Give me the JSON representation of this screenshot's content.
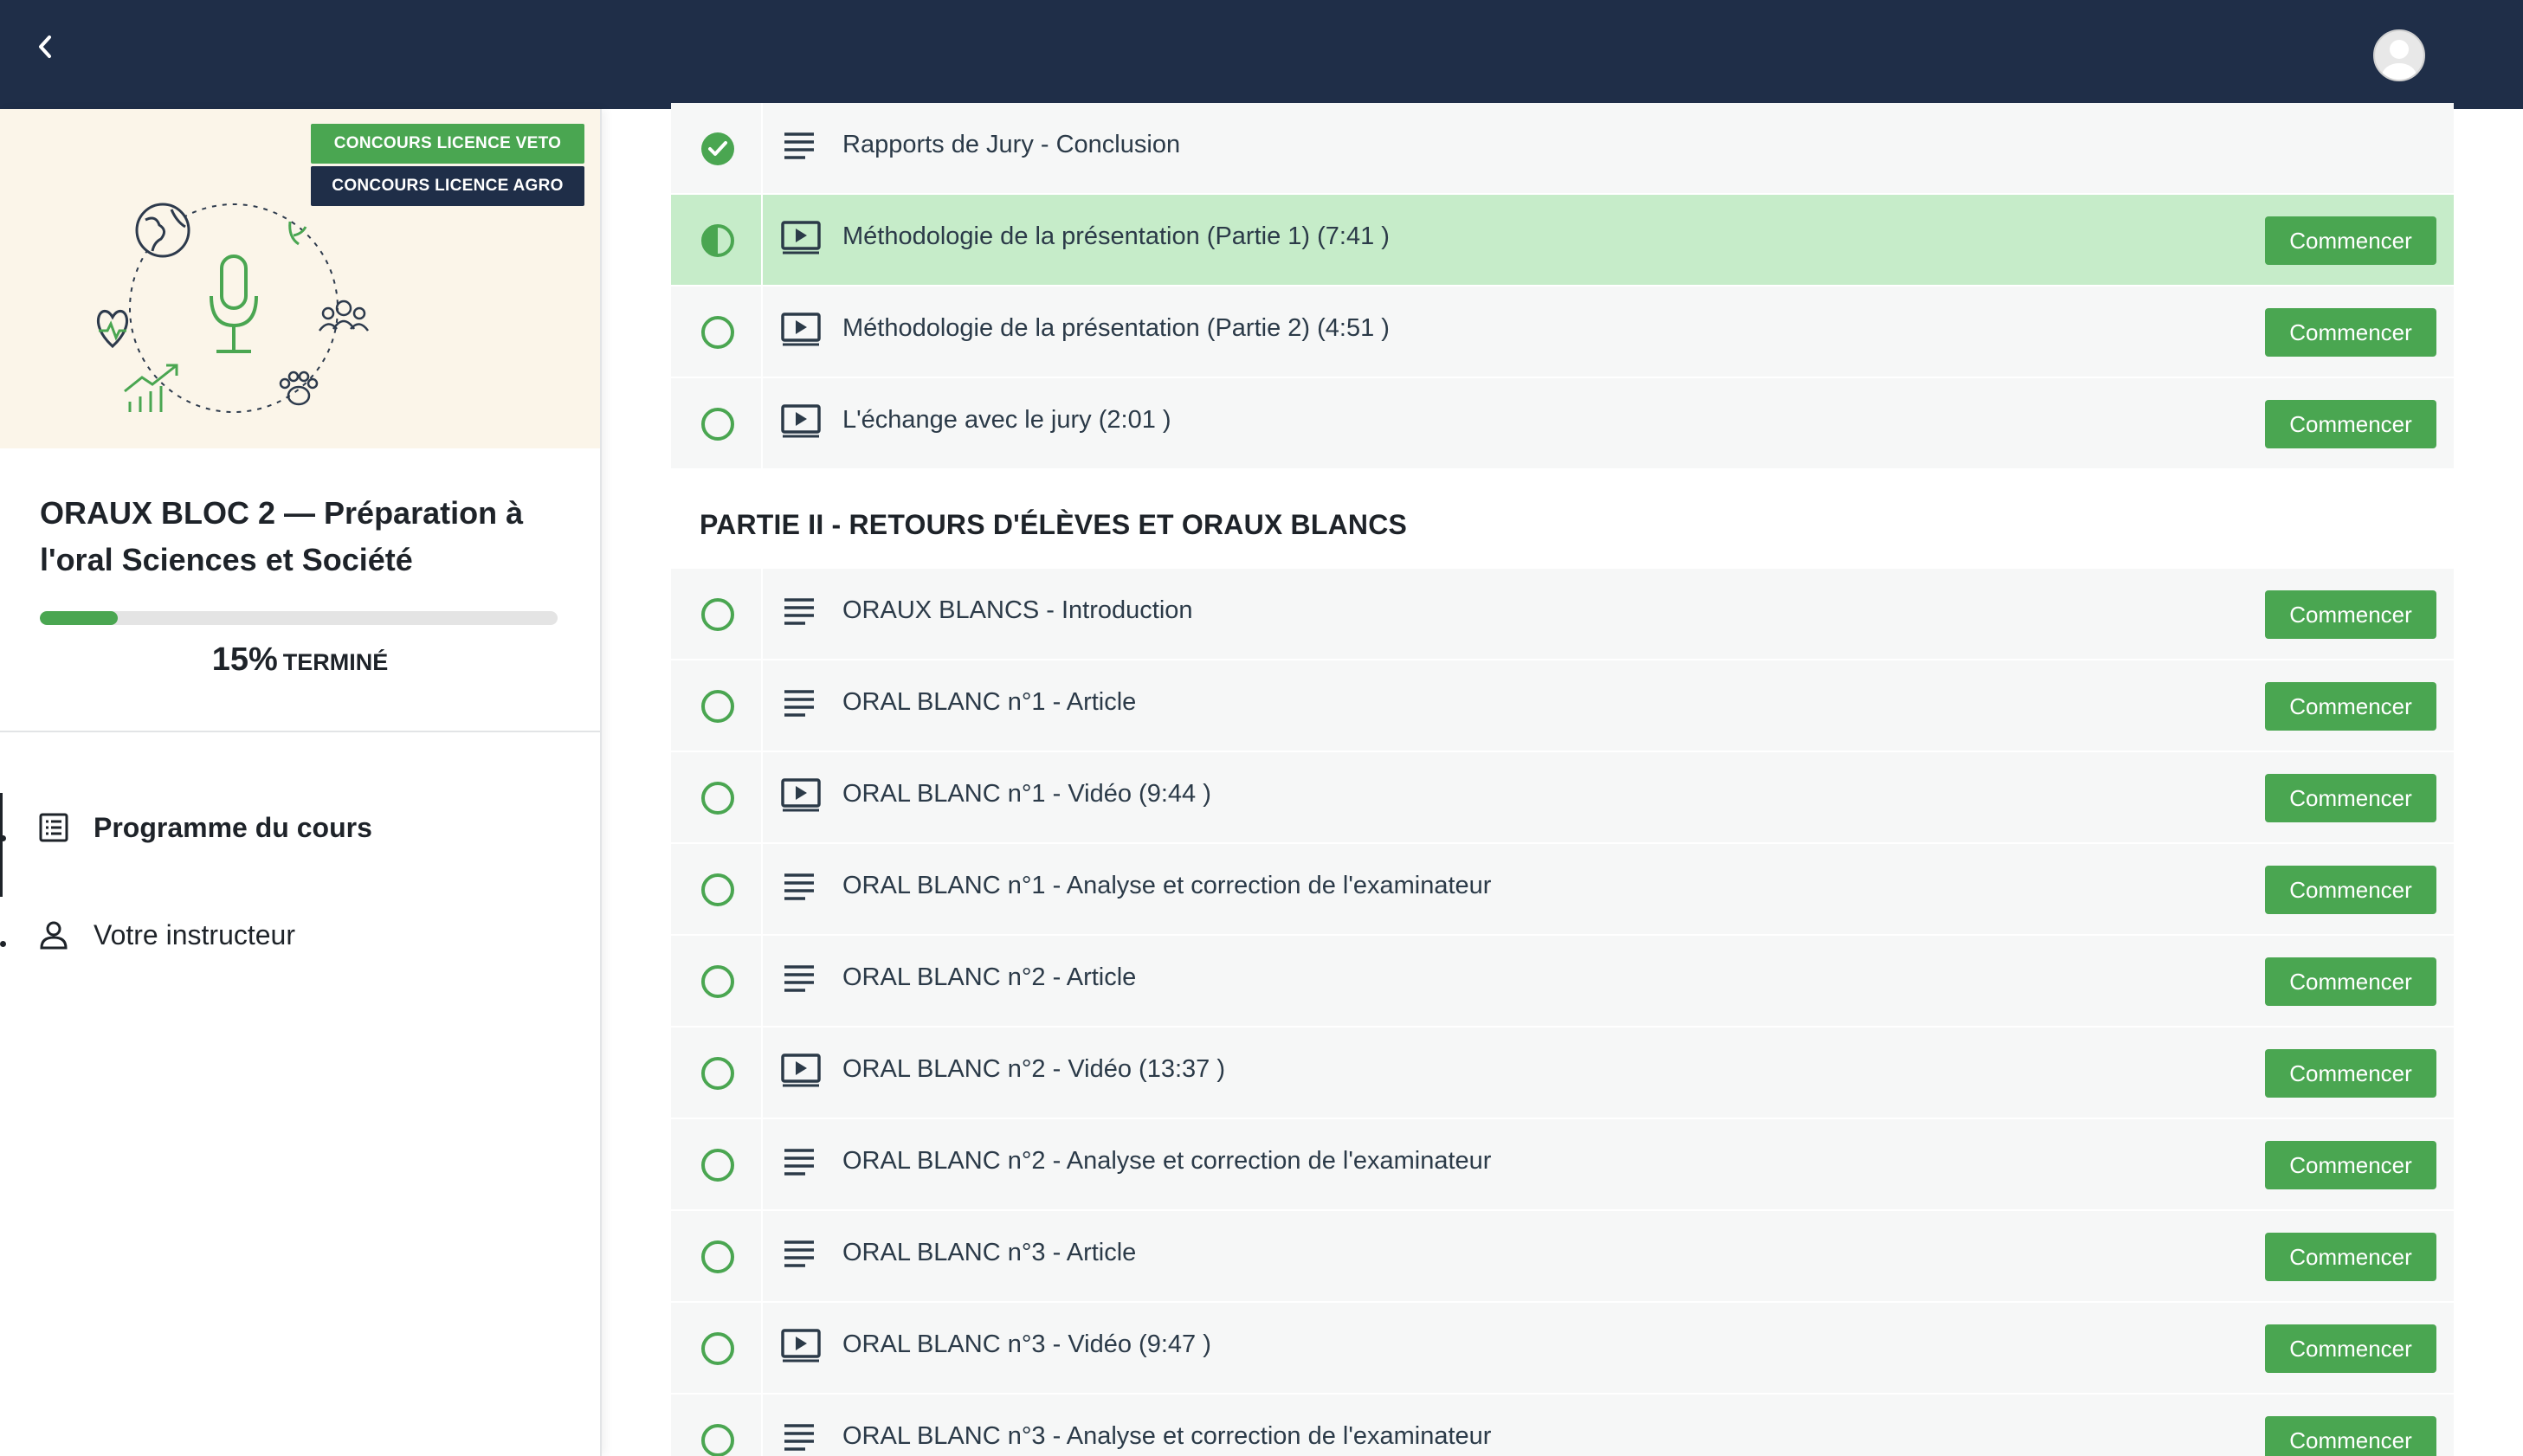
{
  "header": {
    "back_label": "‹",
    "avatar_label": "user-avatar"
  },
  "sidebar": {
    "badges": [
      "CONCOURS LICENCE VETO",
      "CONCOURS LICENCE AGRO"
    ],
    "course_title": "ORAUX BLOC 2 — Préparation à l'oral Sciences et Société",
    "progress": {
      "percent_value": 15,
      "percent_label": "15%",
      "status_label": "TERMINÉ"
    },
    "nav": [
      {
        "label": "Programme du cours",
        "icon": "list-icon",
        "active": true
      },
      {
        "label": "Votre instructeur",
        "icon": "person-icon",
        "active": false
      }
    ]
  },
  "colors": {
    "brand": "#1f2e48",
    "accent": "#4aa651",
    "active_row": "#c6ecc9"
  },
  "lessons_top": [
    {
      "title": "Rapports de Jury - Conclusion",
      "type": "text",
      "status": "complete",
      "button": ""
    },
    {
      "title": "Méthodologie de la présentation (Partie 1) (7:41 )",
      "type": "video",
      "status": "in-progress",
      "button": "Commencer"
    },
    {
      "title": "Méthodologie de la présentation (Partie 2) (4:51 )",
      "type": "video",
      "status": "not-started",
      "button": "Commencer"
    },
    {
      "title": "L'échange avec le jury (2:01 )",
      "type": "video",
      "status": "not-started",
      "button": "Commencer"
    }
  ],
  "section2": {
    "title": "PARTIE II - RETOURS D'ÉLÈVES ET ORAUX BLANCS",
    "lessons": [
      {
        "title": "ORAUX BLANCS - Introduction",
        "type": "text",
        "status": "not-started",
        "button": "Commencer"
      },
      {
        "title": "ORAL BLANC n°1 - Article",
        "type": "text",
        "status": "not-started",
        "button": "Commencer"
      },
      {
        "title": "ORAL BLANC n°1 - Vidéo (9:44 )",
        "type": "video",
        "status": "not-started",
        "button": "Commencer"
      },
      {
        "title": "ORAL BLANC n°1 - Analyse et correction de l'examinateur",
        "type": "text",
        "status": "not-started",
        "button": "Commencer"
      },
      {
        "title": "ORAL BLANC n°2 - Article",
        "type": "text",
        "status": "not-started",
        "button": "Commencer"
      },
      {
        "title": "ORAL BLANC n°2 - Vidéo (13:37 )",
        "type": "video",
        "status": "not-started",
        "button": "Commencer"
      },
      {
        "title": "ORAL BLANC n°2 - Analyse et correction de l'examinateur",
        "type": "text",
        "status": "not-started",
        "button": "Commencer"
      },
      {
        "title": "ORAL BLANC n°3 - Article",
        "type": "text",
        "status": "not-started",
        "button": "Commencer"
      },
      {
        "title": "ORAL BLANC n°3 - Vidéo (9:47 )",
        "type": "video",
        "status": "not-started",
        "button": "Commencer"
      },
      {
        "title": "ORAL BLANC n°3 - Analyse et correction de l'examinateur",
        "type": "text",
        "status": "not-started",
        "button": "Commencer"
      }
    ]
  }
}
